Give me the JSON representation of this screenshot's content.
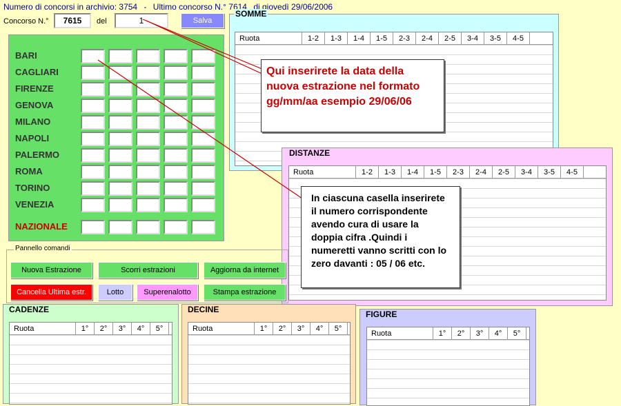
{
  "header": {
    "archive_text": "Numero di concorsi in archivio: 3754",
    "sep": "-",
    "last_text": "Ultimo concorso N.° 7614",
    "date_text": "di giovedì 29/06/2006"
  },
  "form": {
    "concorso_label": "Concorso N.°",
    "concorso_value": "7615",
    "del_label": "del",
    "date_value": "1",
    "save_label": "Salva"
  },
  "cities": [
    "BARI",
    "CAGLIARI",
    "FIRENZE",
    "GENOVA",
    "MILANO",
    "NAPOLI",
    "PALERMO",
    "ROMA",
    "TORINO",
    "VENEZIA"
  ],
  "nazionale_label": "NAZIONALE",
  "somme": {
    "title": "SOMME",
    "headers": [
      "Ruota",
      "1-2",
      "1-3",
      "1-4",
      "1-5",
      "2-3",
      "2-4",
      "2-5",
      "3-4",
      "3-5",
      "4-5"
    ]
  },
  "distanze": {
    "title": "DISTANZE",
    "headers": [
      "Ruota",
      "1-2",
      "1-3",
      "1-4",
      "1-5",
      "2-3",
      "2-4",
      "2-5",
      "3-4",
      "3-5",
      "4-5"
    ]
  },
  "callout_date": "Qui inserirete la data della nuova estrazione nel formato gg/mm/aa esempio 29/06/06",
  "callout_numbers": "In ciascuna casella inserirete il numero corrispondente avendo cura di usare la doppia cifra .Quindi i numeretti vanno scritti con lo zero davanti : 05 / 06 etc.",
  "panel": {
    "legend": "Pannello comandi",
    "nuova": "Nuova Estrazione",
    "scorri": "Scorri estrazioni",
    "aggiorna": "Aggiorna da internet",
    "cancella": "Cancella Ultima estr.",
    "lotto": "Lotto",
    "superenalotto": "Superenalotto",
    "stampa": "Stampa estrazione"
  },
  "cadenze": {
    "title": "CADENZE",
    "headers": [
      "Ruota",
      "1°",
      "2°",
      "3°",
      "4°",
      "5°"
    ]
  },
  "decine": {
    "title": "DECINE",
    "headers": [
      "Ruota",
      "1°",
      "2°",
      "3°",
      "4°",
      "5°"
    ]
  },
  "figure": {
    "title": "FIGURE",
    "headers": [
      "Ruota",
      "1°",
      "2°",
      "3°",
      "4°",
      "5°"
    ]
  },
  "colors": {
    "bg": "#ffffc6",
    "green": "#66e066",
    "cyan": "#ccffff",
    "pink": "#ffccff",
    "orange": "#ffe0b8",
    "lavender": "#ccccff",
    "red": "#ff0000",
    "accent_text": "#cc0000"
  }
}
